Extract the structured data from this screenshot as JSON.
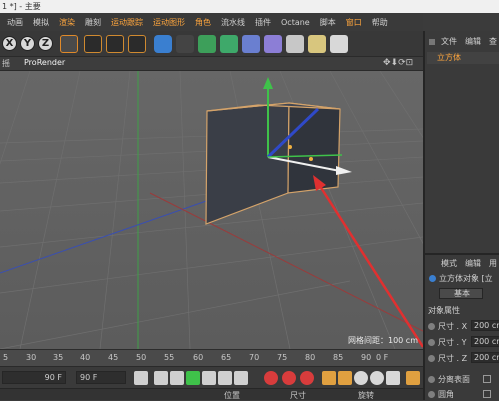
{
  "window": {
    "title": "1 *] - 主要"
  },
  "menu": [
    "动画",
    "模拟",
    "渲染",
    "雕刻",
    "运动跟踪",
    "运动图形",
    "角色",
    "流水线",
    "插件",
    "Octane",
    "脚本",
    "窗口",
    "帮助"
  ],
  "toolbar": {
    "axis_x": "X",
    "axis_y": "Y",
    "axis_z": "Z"
  },
  "viewport": {
    "tab_label": "摇",
    "renderer": "ProRender",
    "grid_spacing": "网格间距：100 cm"
  },
  "timeline": {
    "ticks": [
      "5",
      "30",
      "35",
      "40",
      "45",
      "50",
      "55",
      "60",
      "65",
      "70",
      "75",
      "80",
      "85",
      "90",
      "0 F"
    ]
  },
  "transport": {
    "frame_start": "90 F",
    "frame_end": "90 F"
  },
  "bottom": {
    "position_label": "位置",
    "size_label": "尺寸",
    "rotation_label": "旋转"
  },
  "object_manager": {
    "tabs": [
      "文件",
      "编辑",
      "查"
    ],
    "object_name": "立方体"
  },
  "attributes": {
    "tabs": [
      "模式",
      "编辑",
      "用"
    ],
    "object_title": "立方体对象 [立",
    "basic_tab": "基本",
    "section": "对象属性",
    "fields": [
      {
        "label": "尺寸 . X",
        "value": "200 cm"
      },
      {
        "label": "尺寸 . Y",
        "value": "200 cm"
      },
      {
        "label": "尺寸 . Z",
        "value": "200 cm"
      }
    ],
    "separate_surfaces": "分离表面",
    "fillet": "圆角"
  },
  "colors": {
    "accent": "#ffa63d",
    "arrow": "#e03030",
    "selection_edge": "#d4a36a"
  }
}
